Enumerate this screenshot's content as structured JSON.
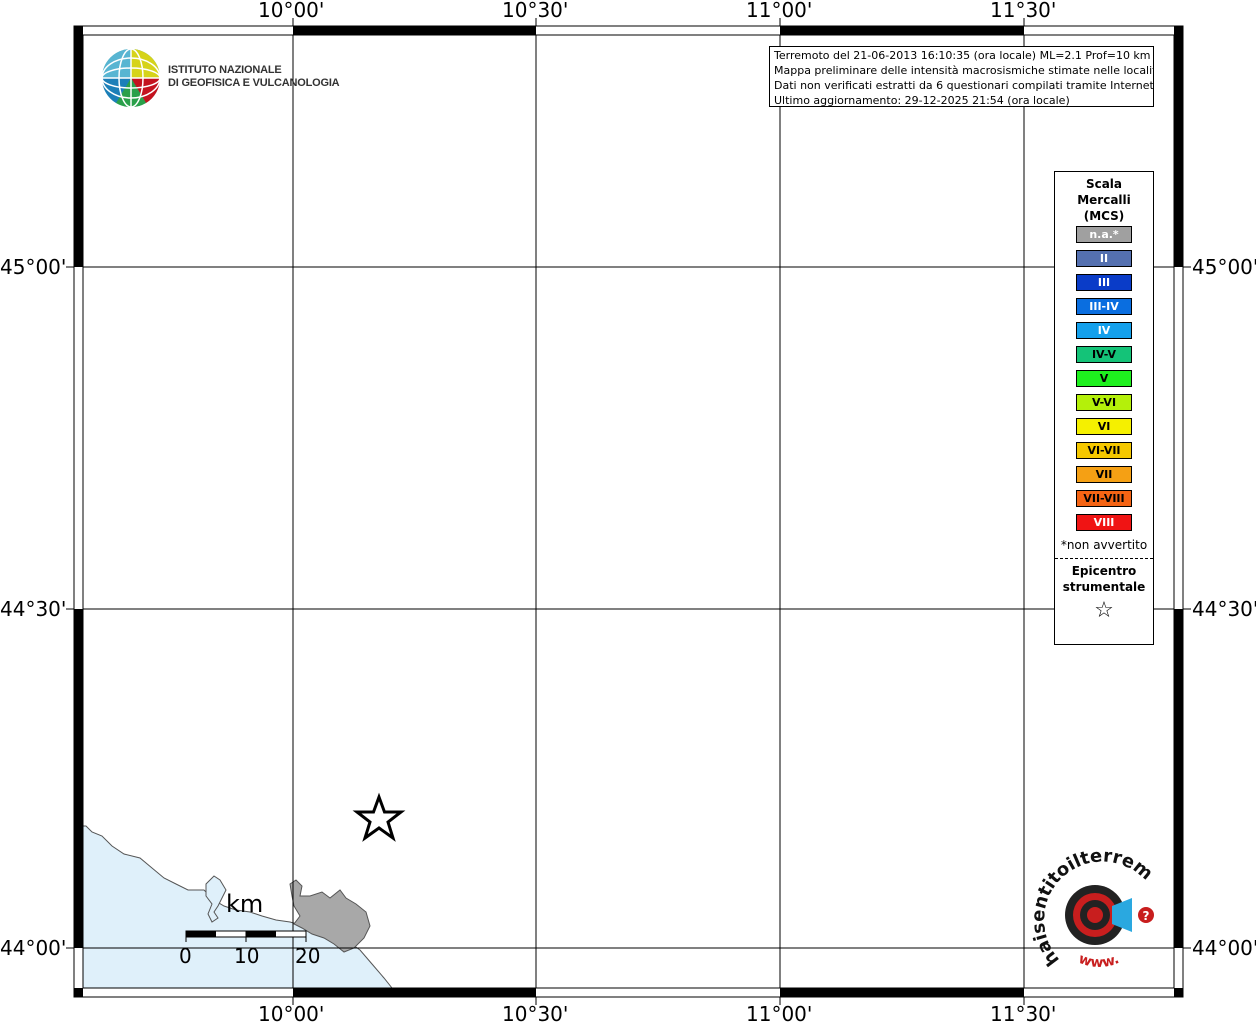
{
  "map": {
    "top_lon_labels": [
      "10°00'",
      "10°30'",
      "11°00'",
      "11°30'"
    ],
    "bottom_lon_labels": [
      "10°00'",
      "10°30'",
      "11°00'",
      "11°30'"
    ],
    "left_lat_labels": [
      "45°00'",
      "44°30'",
      "44°00'"
    ],
    "right_lat_labels": [
      "45°00'",
      "44°30'",
      "44°00'"
    ],
    "colors": {
      "sea": "#dff0fa",
      "land_gray": "#a8a8a8",
      "grid": "#000000"
    }
  },
  "logo": {
    "line1": "ISTITUTO NAZIONALE",
    "line2": "DI GEOFISICA E VULCANOLOGIA"
  },
  "info": {
    "line1": "Terremoto del 21-06-2013 16:10:35 (ora locale) ML=2.1 Prof=10 km",
    "line2": "Mappa preliminare delle intensità macrosismiche stimate nelle località",
    "line3": "Dati non verificati estratti da 6 questionari compilati tramite Internet.",
    "line4": "Ultimo aggiornamento: 29-12-2025 21:54 (ora locale)"
  },
  "legend": {
    "title_line1": "Scala",
    "title_line2": "Mercalli",
    "title_line3": "(MCS)",
    "items": [
      {
        "label": "n.a.*",
        "color": "#a0a0a0"
      },
      {
        "label": "II",
        "color": "#5470b0"
      },
      {
        "label": "III",
        "color": "#0a3cc8"
      },
      {
        "label": "III-IV",
        "color": "#0a6ee0"
      },
      {
        "label": "IV",
        "color": "#14a0ec"
      },
      {
        "label": "IV-V",
        "color": "#14c378"
      },
      {
        "label": "V",
        "color": "#1ef01e"
      },
      {
        "label": "V-VI",
        "color": "#b4f00a"
      },
      {
        "label": "VI",
        "color": "#f5f000"
      },
      {
        "label": "VI-VII",
        "color": "#f5c800"
      },
      {
        "label": "VII",
        "color": "#f5a014"
      },
      {
        "label": "VII-VIII",
        "color": "#f56414"
      },
      {
        "label": "VIII",
        "color": "#f01414"
      }
    ],
    "note": "*non avvertito",
    "epicenter_line1": "Epicentro",
    "epicenter_line2": "strumentale",
    "epicenter_symbol": "☆"
  },
  "scale_bar": {
    "unit": "km",
    "ticks": [
      "0",
      "10",
      "20"
    ]
  },
  "hsit_logo": {
    "text": "haisentitoilterremoto.it",
    "url_text": "www."
  },
  "epicenter_icon": "star-icon"
}
